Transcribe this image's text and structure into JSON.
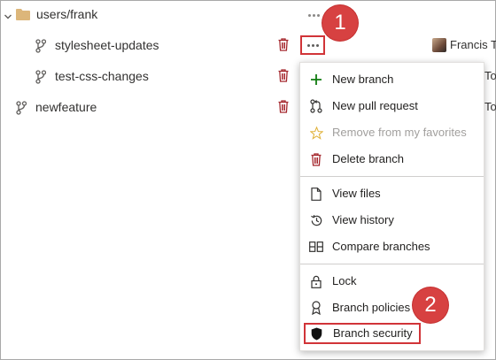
{
  "tree": {
    "folder": {
      "label": "users/frank"
    },
    "rows": [
      {
        "label": "stylesheet-updates",
        "author": "Francis To"
      },
      {
        "label": "test-css-changes",
        "author": "To"
      },
      {
        "label": "newfeature",
        "author": "To"
      }
    ]
  },
  "callouts": {
    "first": "1",
    "second": "2"
  },
  "menu": {
    "new_branch": "New branch",
    "new_pull_request": "New pull request",
    "remove_favorites": "Remove from my favorites",
    "delete_branch": "Delete branch",
    "view_files": "View files",
    "view_history": "View history",
    "compare_branches": "Compare branches",
    "lock": "Lock",
    "branch_policies": "Branch policies",
    "branch_security": "Branch security"
  },
  "colors": {
    "callout": "#d74141",
    "highlight_border": "#d13438",
    "delete_icon": "#a4262c",
    "add_icon": "#107c10",
    "folder": "#dcb67a"
  }
}
